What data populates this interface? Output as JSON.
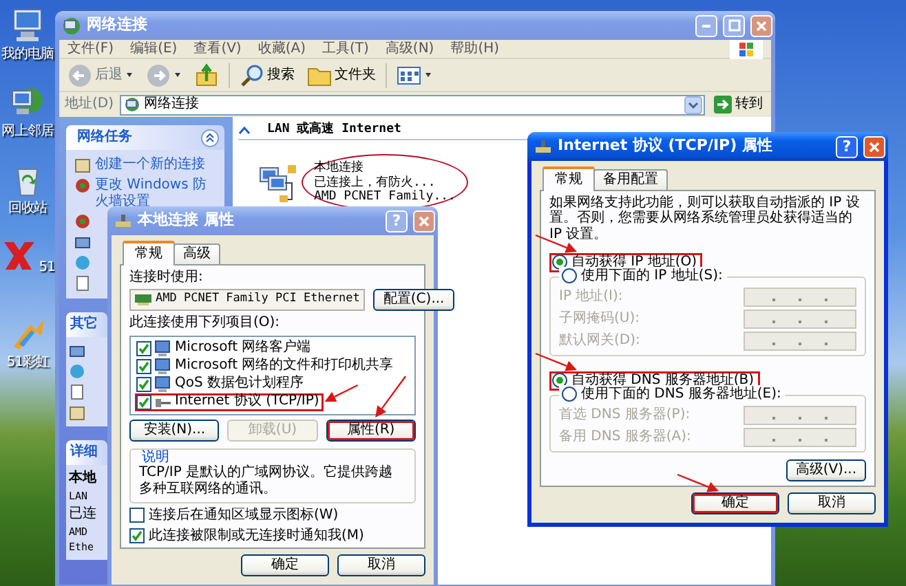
{
  "desktop_icons": [
    {
      "kind": "computer",
      "label": "我的电脑"
    },
    {
      "kind": "network",
      "label": "网上邻居"
    },
    {
      "kind": "recycle",
      "label": "回收站"
    },
    {
      "kind": "app",
      "icon_text": "51"
    },
    {
      "kind": "rainbow",
      "label": "51彩虹"
    }
  ],
  "explorer": {
    "title": "网络连接",
    "active": false,
    "menu": [
      "文件(F)",
      "编辑(E)",
      "查看(V)",
      "收藏(A)",
      "工具(T)",
      "高级(N)",
      "帮助(H)"
    ],
    "toolbar": [
      {
        "kind": "back",
        "label": "后退"
      },
      {
        "kind": "forward"
      },
      {
        "kind": "up"
      },
      {
        "kind": "search",
        "label": "搜索"
      },
      {
        "kind": "folders",
        "label": "文件夹"
      },
      {
        "kind": "views"
      }
    ],
    "address": {
      "label": "地址(D)",
      "value": "网络连接",
      "go": "转到"
    },
    "task_panels": [
      {
        "kind": "tasks",
        "title": "网络任务",
        "items": [
          "创建一个新的连接",
          "更改 Windows 防火墙设置"
        ]
      },
      {
        "kind": "other",
        "title": "其它"
      },
      {
        "kind": "details",
        "title": "详细",
        "name": "本地",
        "lines": [
          "LAN",
          "已连",
          "AMD",
          "Ethe"
        ]
      }
    ],
    "group_header": "LAN 或高速 Internet",
    "connection": {
      "name": "本地连接",
      "status": "已连接上，有防火...",
      "device": "AMD PCNET Family...",
      "highlighted": true
    }
  },
  "left_dialog": {
    "title": "本地连接 属性",
    "active": false,
    "help": "?",
    "tabs": [
      {
        "label": "常规",
        "selected": true
      },
      {
        "label": "高级",
        "selected": false
      }
    ],
    "connect_using_label": "连接时使用:",
    "adapter": "AMD PCNET Family PCI Ethernet",
    "configure_button": "配置(C)...",
    "items_label": "此连接使用下列项目(O):",
    "items": [
      {
        "label": "Microsoft 网络客户端",
        "checked": true,
        "highlighted": false
      },
      {
        "label": "Microsoft 网络的文件和打印机共享",
        "checked": true,
        "highlighted": false
      },
      {
        "label": "QoS 数据包计划程序",
        "checked": true,
        "highlighted": false
      },
      {
        "label": "Internet 协议 (TCP/IP)",
        "checked": true,
        "highlighted": true
      }
    ],
    "item_buttons": [
      {
        "label": "安装(N)...",
        "disabled": false,
        "highlighted": false
      },
      {
        "label": "卸载(U)",
        "disabled": true,
        "highlighted": false
      },
      {
        "label": "属性(R)",
        "disabled": false,
        "highlighted": true
      }
    ],
    "description_title": "说明",
    "description": "TCP/IP 是默认的广域网协议。它提供跨越多种互联网络的通讯。",
    "options": [
      {
        "label": "连接后在通知区域显示图标(W)",
        "checked": false
      },
      {
        "label": "此连接被限制或无连接时通知我(M)",
        "checked": true
      }
    ],
    "buttons": [
      {
        "label": "确定"
      },
      {
        "label": "取消"
      }
    ]
  },
  "right_dialog": {
    "title": "Internet 协议 (TCP/IP) 属性",
    "active": true,
    "help": "?",
    "tabs": [
      {
        "label": "常规",
        "selected": true
      },
      {
        "label": "备用配置",
        "selected": false
      }
    ],
    "intro": "如果网络支持此功能，则可以获取自动指派的 IP 设置。否则，您需要从网络系统管理员处获得适当的 IP 设置。",
    "ip_modes": [
      {
        "label": "自动获得 IP 地址(O)",
        "selected": true,
        "highlighted": true
      },
      {
        "label": "使用下面的 IP 地址(S):",
        "selected": false,
        "highlighted": false
      }
    ],
    "ip_fields": [
      {
        "label": "IP 地址(I):",
        "disabled": true
      },
      {
        "label": "子网掩码(U):",
        "disabled": true
      },
      {
        "label": "默认网关(D):",
        "disabled": true
      }
    ],
    "dns_modes": [
      {
        "label": "自动获得 DNS 服务器地址(B)",
        "selected": true,
        "highlighted": true
      },
      {
        "label": "使用下面的 DNS 服务器地址(E):",
        "selected": false,
        "highlighted": false
      }
    ],
    "dns_fields": [
      {
        "label": "首选 DNS 服务器(P):",
        "disabled": true
      },
      {
        "label": "备用 DNS 服务器(A):",
        "disabled": true
      }
    ],
    "advanced_button": "高级(V)...",
    "buttons": [
      {
        "label": "确定",
        "highlighted": true
      },
      {
        "label": "取消",
        "highlighted": false
      }
    ]
  }
}
